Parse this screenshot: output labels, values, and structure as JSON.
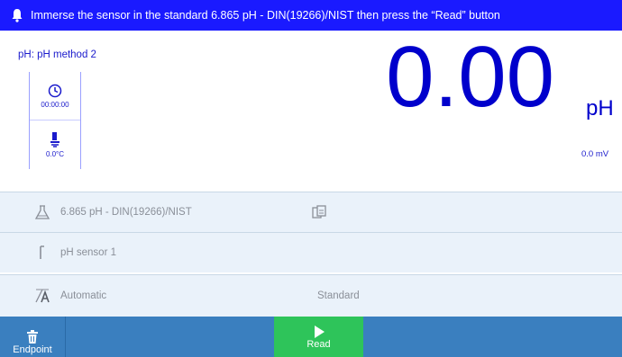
{
  "banner": {
    "message": "Immerse the sensor in the standard 6.865 pH - DIN(19266)/NIST then press the  “Read”   button",
    "icon": "bell-icon"
  },
  "method": {
    "label": "pH: pH method 2"
  },
  "status": {
    "timer": "00:00:00",
    "temperature": "0.0°C"
  },
  "measurement": {
    "value": "0.00",
    "unit": "pH",
    "mv": "0.0 mV"
  },
  "rows": {
    "standard": "6.865 pH - DIN(19266)/NIST",
    "sensor": "pH sensor 1",
    "mode": "Automatic",
    "mode_type": "Standard"
  },
  "bottom": {
    "endpoint_label": "Endpoint",
    "read_label": "Read"
  },
  "colors": {
    "banner": "#1a1aff",
    "accent": "#0000cc",
    "bottom_bar": "#3a7fbf",
    "read_button": "#2ec45a"
  }
}
